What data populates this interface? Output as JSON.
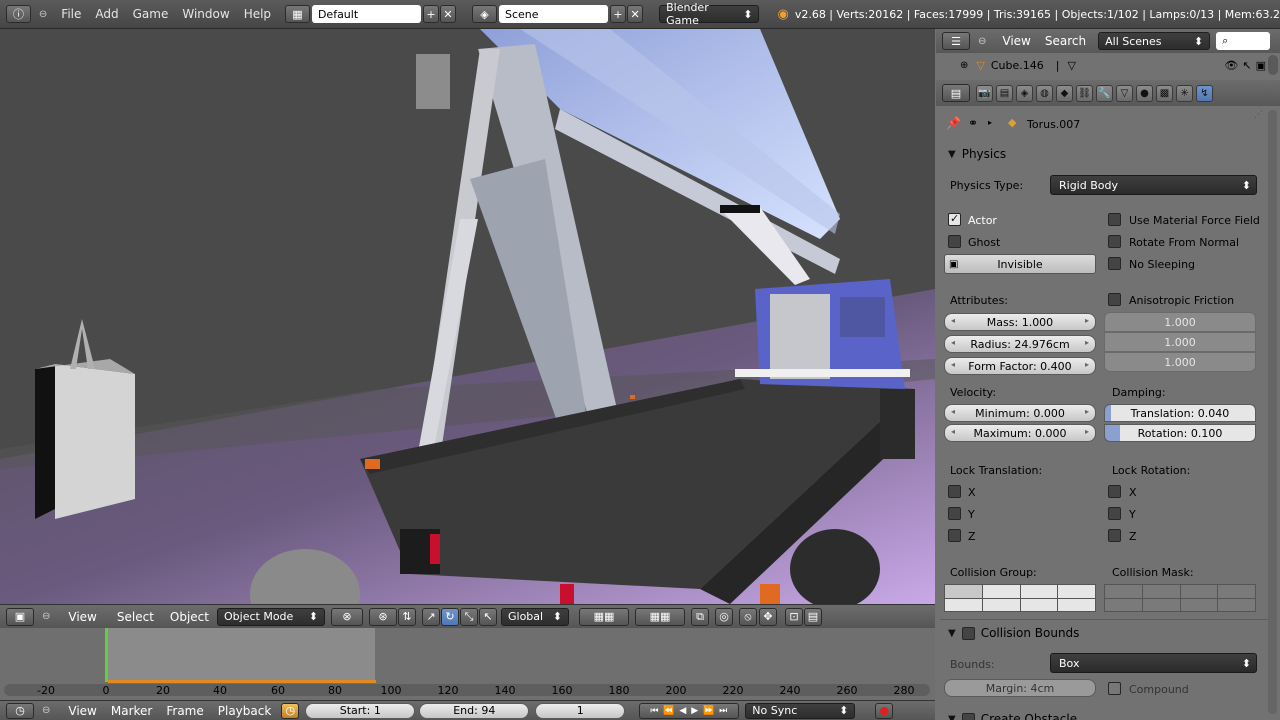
{
  "topbar": {
    "menus": [
      "File",
      "Add",
      "Game",
      "Window",
      "Help"
    ],
    "layout": "Default",
    "scene": "Scene",
    "engine": "Blender Game",
    "stats": "v2.68 | Verts:20162 | Faces:17999 | Tris:39165 | Objects:1/102 | Lamps:0/13 | Mem:63.2"
  },
  "viewport_header": {
    "menus": [
      "View",
      "Select",
      "Object"
    ],
    "mode": "Object Mode",
    "orientation": "Global"
  },
  "timeline": {
    "ticks": [
      "-20",
      "0",
      "20",
      "40",
      "60",
      "80",
      "100",
      "120",
      "140",
      "160",
      "180",
      "200",
      "220",
      "240",
      "260",
      "280"
    ],
    "menus": [
      "View",
      "Marker",
      "Frame",
      "Playback"
    ],
    "start": "Start: 1",
    "end": "End: 94",
    "current": "1",
    "sync": "No Sync"
  },
  "outliner": {
    "menus": [
      "View",
      "Search"
    ],
    "filter": "All Scenes",
    "item": "Cube.146"
  },
  "properties": {
    "object_name": "Torus.007",
    "physics_title": "Physics",
    "physics_type_label": "Physics Type:",
    "physics_type": "Rigid Body",
    "actor": "Actor",
    "ghost": "Ghost",
    "invisible": "Invisible",
    "use_material_force": "Use Material Force Field",
    "rotate_from_normal": "Rotate From Normal",
    "no_sleeping": "No Sleeping",
    "attributes": "Attributes:",
    "anisotropic": "Anisotropic Friction",
    "mass": "Mass: 1.000",
    "radius": "Radius: 24.976cm",
    "form_factor": "Form Factor: 0.400",
    "aniso_values": [
      "1.000",
      "1.000",
      "1.000"
    ],
    "velocity": "Velocity:",
    "minimum": "Minimum: 0.000",
    "maximum": "Maximum: 0.000",
    "damping": "Damping:",
    "translation": "Translation: 0.040",
    "rotation": "Rotation: 0.100",
    "lock_translation": "Lock Translation:",
    "lock_rotation": "Lock Rotation:",
    "axes": [
      "X",
      "Y",
      "Z"
    ],
    "collision_group": "Collision Group:",
    "collision_mask": "Collision Mask:",
    "collision_bounds": "Collision Bounds",
    "bounds_label": "Bounds:",
    "bounds": "Box",
    "margin": "Margin: 4cm",
    "compound": "Compound",
    "create_obstacle": "Create Obstacle"
  }
}
